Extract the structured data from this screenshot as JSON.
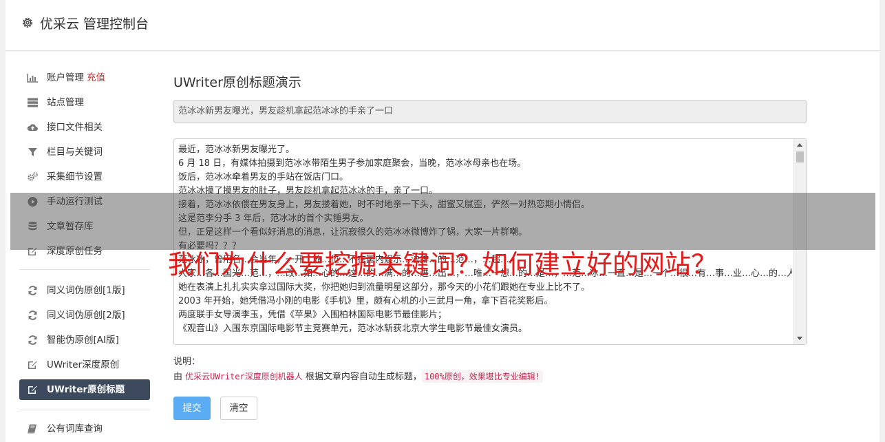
{
  "header": {
    "title": "优采云 管理控制台",
    "icon": "gear-icon"
  },
  "sidebar": {
    "items": [
      {
        "label": "账户管理",
        "extra": "充值",
        "icon": "bar-chart-icon"
      },
      {
        "label": "站点管理",
        "icon": "server-icon"
      },
      {
        "label": "接口文件相关",
        "icon": "cloud-upload-icon"
      },
      {
        "label": "栏目与关键词",
        "icon": "filter-icon"
      },
      {
        "label": "采集细节设置",
        "icon": "cogs-icon"
      },
      {
        "label": "手动运行测试",
        "icon": "play-circle-icon"
      },
      {
        "label": "文章暂存库",
        "icon": "database-icon"
      },
      {
        "label": "深度原创任务",
        "icon": "edit-icon"
      },
      {
        "label": "同义词伪原创[1版]",
        "icon": "refresh-icon"
      },
      {
        "label": "同义词伪原创[2版]",
        "icon": "refresh-icon"
      },
      {
        "label": "智能伪原创[AI版]",
        "icon": "refresh-icon"
      },
      {
        "label": "UWriter深度原创",
        "icon": "edit-icon"
      },
      {
        "label": "UWriter原创标题",
        "icon": "edit-icon",
        "active": true
      },
      {
        "label": "公有词库查询",
        "icon": "book-icon"
      }
    ]
  },
  "main": {
    "heading": "UWriter原创标题演示",
    "title_value": "范冰冰新男友曝光，男友趁机拿起范冰冰的手亲了一口",
    "article_lines": [
      "最近，范冰冰新男友曝光了。",
      "6 月 18 日，有媒体拍摄到范冰冰带陌生男子参加家庭聚会，当晚，范冰冰母亲也在场。",
      "饭后，范冰冰牵着男友的手站在饭店门口。",
      "范冰冰摸了摸男友的肚子，男友趁机拿起范冰冰的手，亲了一口。",
      "接着，范冰冰依偎在男友身上，男友搂着她，时不时地亲一下头，甜蜜又腻歪，俨然一对热恋期小情侣。",
      "这是范李分手 3 年后，范冰冰的首个实锤男友。",
      "但，正是这样一个看似好消息的消息，让沉寂很久的范冰冰微博炸了锅，大家一片群嘲。",
      "有必要吗？？？",
      "范冰冰，曾用名…会当年，一开…放…位…不在国内娱乐…法排…的…范…，…超…",
      "大家…各…国光…范…，…改…如…心的…这…的…满…的…进…出…，…唯…一想…的…是…，…范…冰…一直…是…一个…很…有…事…业…心…的…人。",
      "她在表演上扎扎实实拿过国际大奖，你把她归到流量明星这部分，那今天的小花们跟她在专业上比不了。",
      "2003 年开始，她凭借冯小刚的电影《手机》里，颇有心机的小三武月一角，拿下百花奖影后。",
      "两度联手女导演李玉，凭借《苹果》入围柏林国际电影节最佳影片；",
      "《观音山》入围东京国际电影节主竞赛单元，范冰冰斩获北京大学生电影节最佳女演员。"
    ],
    "note_label": "说明：",
    "note_prefix": "由 ",
    "note_link": "优采云UWriter深度原创机器人",
    "note_middle": " 根据文章内容自动生成标题，",
    "note_badge": "100%原创，效果堪比专业编辑!",
    "submit_label": "提交",
    "clear_label": "清空"
  },
  "overlay": {
    "text": "我们为什么要挖掘关键词？如何建立好的网站？"
  },
  "colors": {
    "active_nav": "#3d4a5e",
    "primary_button": "#5bacf2",
    "highlight_red": "#c9302c",
    "overlay_text": "#e31b1b"
  }
}
